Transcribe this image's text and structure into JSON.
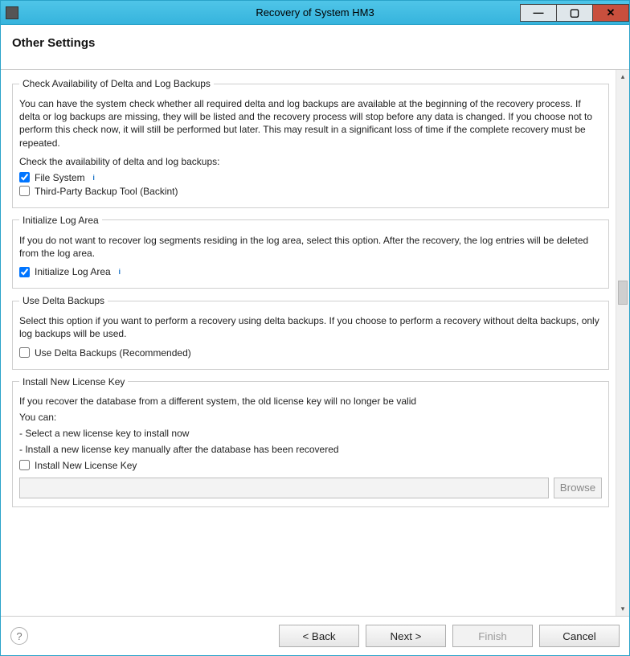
{
  "window": {
    "title": "Recovery of System HM3"
  },
  "page": {
    "title": "Other Settings"
  },
  "deltaLog": {
    "legend": "Check Availability of Delta and Log Backups",
    "desc": "You can have the system check whether all required delta and log backups are available at the beginning of the recovery process. If delta or log backups are missing, they will be listed and the recovery process will stop before any data is changed. If you choose not to perform this check now, it will still be performed but later. This may result in a significant loss of time if the complete recovery must be repeated.",
    "sub": "Check the availability of delta and log backups:",
    "fileSystem": {
      "label": "File System",
      "checked": true
    },
    "backint": {
      "label": "Third-Party Backup Tool (Backint)",
      "checked": false
    }
  },
  "initLog": {
    "legend": "Initialize Log Area",
    "desc": "If you do not want to recover log segments residing in the log area, select this option. After the recovery, the log entries will be deleted from the log area.",
    "cb": {
      "label": "Initialize Log Area",
      "checked": true
    }
  },
  "useDelta": {
    "legend": "Use Delta Backups",
    "desc": "Select this option if you want to perform a recovery using delta backups. If you choose to perform a recovery without delta backups, only log backups will be used.",
    "cb": {
      "label": "Use Delta Backups (Recommended)",
      "checked": false
    }
  },
  "license": {
    "legend": "Install New License Key",
    "desc1": "If you recover the database from a different system, the old license key will no longer be valid",
    "desc2": "You can:",
    "bullet1": "- Select a new license key to install now",
    "bullet2": "- Install a new license key manually after the database has been recovered",
    "cb": {
      "label": "Install New License Key",
      "checked": false
    },
    "browse": "Browse",
    "path": ""
  },
  "footer": {
    "back": "< Back",
    "next": "Next >",
    "finish": "Finish",
    "cancel": "Cancel"
  }
}
